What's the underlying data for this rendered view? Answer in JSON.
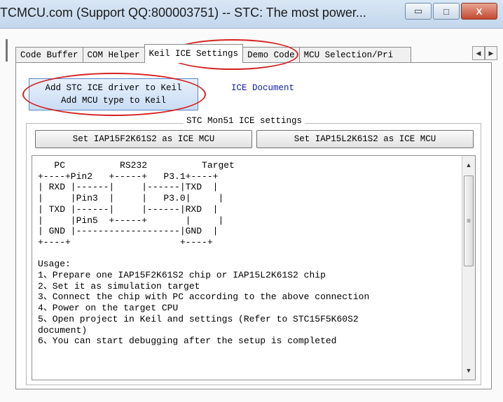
{
  "window": {
    "title": "TCMCU.com (Support QQ:800003751) -- STC: The most power...",
    "minimize_glyph": "▭",
    "maximize_glyph": "□",
    "close_glyph": "X"
  },
  "tabs": [
    {
      "label": "Code Buffer"
    },
    {
      "label": "COM Helper"
    },
    {
      "label": "Keil ICE Settings",
      "active": true
    },
    {
      "label": "Demo Code"
    },
    {
      "label": "MCU Selection/Pri"
    }
  ],
  "tab_scroll": {
    "left_glyph": "◀",
    "right_glyph": "▶"
  },
  "ice_page": {
    "driver_button": {
      "line1": "Add STC ICE driver to Keil",
      "line2": "Add MCU type to Keil"
    },
    "ice_doc_link": "ICE Document",
    "group_title": "STC Mon51 ICE settings",
    "set_buttons": [
      {
        "label": "Set IAP15F2K61S2 as ICE MCU"
      },
      {
        "label": "Set IAP15L2K61S2 as ICE MCU"
      }
    ],
    "text_area": {
      "content": "   PC          RS232          Target\n+----+Pin2   +-----+   P3.1+----+\n| RXD |------|     |------|TXD  |\n|     |Pin3  |     |   P3.0|     |\n| TXD |------|     |------|RXD  |\n|     |Pin5  +-----+       |     |\n| GND |-------------------|GND  |\n+----+                    +----+\n\nUsage:\n1、Prepare one IAP15F2K61S2 chip or IAP15L2K61S2 chip\n2、Set it as simulation target\n3、Connect the chip with PC according to the above connection\n4、Power on the target CPU\n5、Open project in Keil and settings (Refer to STC15F5K60S2\ndocument)\n6、You can start debugging after the setup is completed"
    },
    "scrollbar": {
      "up_glyph": "▲",
      "down_glyph": "▼",
      "grip_glyph": "≡"
    }
  },
  "colors": {
    "annotation": "#d42222",
    "link": "#0b1ea8",
    "button_blue": "#5b87c7"
  }
}
